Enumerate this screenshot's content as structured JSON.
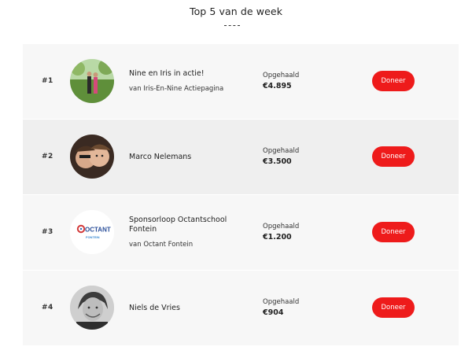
{
  "header": {
    "title": "Top 5 van de week"
  },
  "entries": [
    {
      "rank": "#1",
      "name": "Nine en Iris in actie!",
      "subtitle": "van Iris-En-Nine Actiepagina",
      "raised_label": "Opgehaald",
      "amount": "€4.895",
      "button_label": "Doneer"
    },
    {
      "rank": "#2",
      "name": "Marco Nelemans",
      "subtitle": "",
      "raised_label": "Opgehaald",
      "amount": "€3.500",
      "button_label": "Doneer"
    },
    {
      "rank": "#3",
      "name": "Sponsorloop Octantschool Fontein",
      "subtitle": "van Octant Fontein",
      "raised_label": "Opgehaald",
      "amount": "€1.200",
      "button_label": "Doneer",
      "logo_text_main": "OCTANT",
      "logo_text_sub": "FONTEIN"
    },
    {
      "rank": "#4",
      "name": "Niels de Vries",
      "subtitle": "",
      "raised_label": "Opgehaald",
      "amount": "€904",
      "button_label": "Doneer"
    }
  ],
  "colors": {
    "accent": "#ee1b1b",
    "row_light": "#f7f7f7",
    "row_dark": "#efefef"
  }
}
